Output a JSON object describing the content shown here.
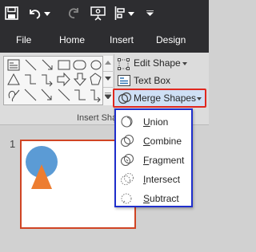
{
  "quick_access": {
    "icons": [
      "save-icon",
      "undo-icon",
      "undo-dropdown-icon",
      "redo-icon",
      "start-slideshow-icon",
      "align-icon",
      "align-dropdown-icon",
      "customize-toolbar-icon"
    ]
  },
  "tabs": [
    {
      "label": "File"
    },
    {
      "label": "Home"
    },
    {
      "label": "Insert"
    },
    {
      "label": "Design"
    }
  ],
  "ribbon": {
    "edit_shape_label": "Edit Shape",
    "text_box_label": "Text Box",
    "merge_shapes_label": "Merge Shapes",
    "group_label": "Insert Sha"
  },
  "merge_menu": {
    "items": [
      {
        "label": "Union",
        "icon": "union-icon"
      },
      {
        "label": "Combine",
        "icon": "combine-icon"
      },
      {
        "label": "Fragment",
        "icon": "fragment-icon"
      },
      {
        "label": "Intersect",
        "icon": "intersect-icon"
      },
      {
        "label": "Subtract",
        "icon": "subtract-icon"
      }
    ]
  },
  "slide_panel": {
    "slide_number": "1"
  },
  "colors": {
    "title_bar": "#2d2d30",
    "ribbon": "#dcdcdc",
    "merge_highlight": "#e0281f",
    "dropdown_border": "#1f2fcc",
    "slide_border": "#d04423",
    "circle_fill": "#5b9bd5",
    "triangle_fill": "#ed7d31"
  }
}
